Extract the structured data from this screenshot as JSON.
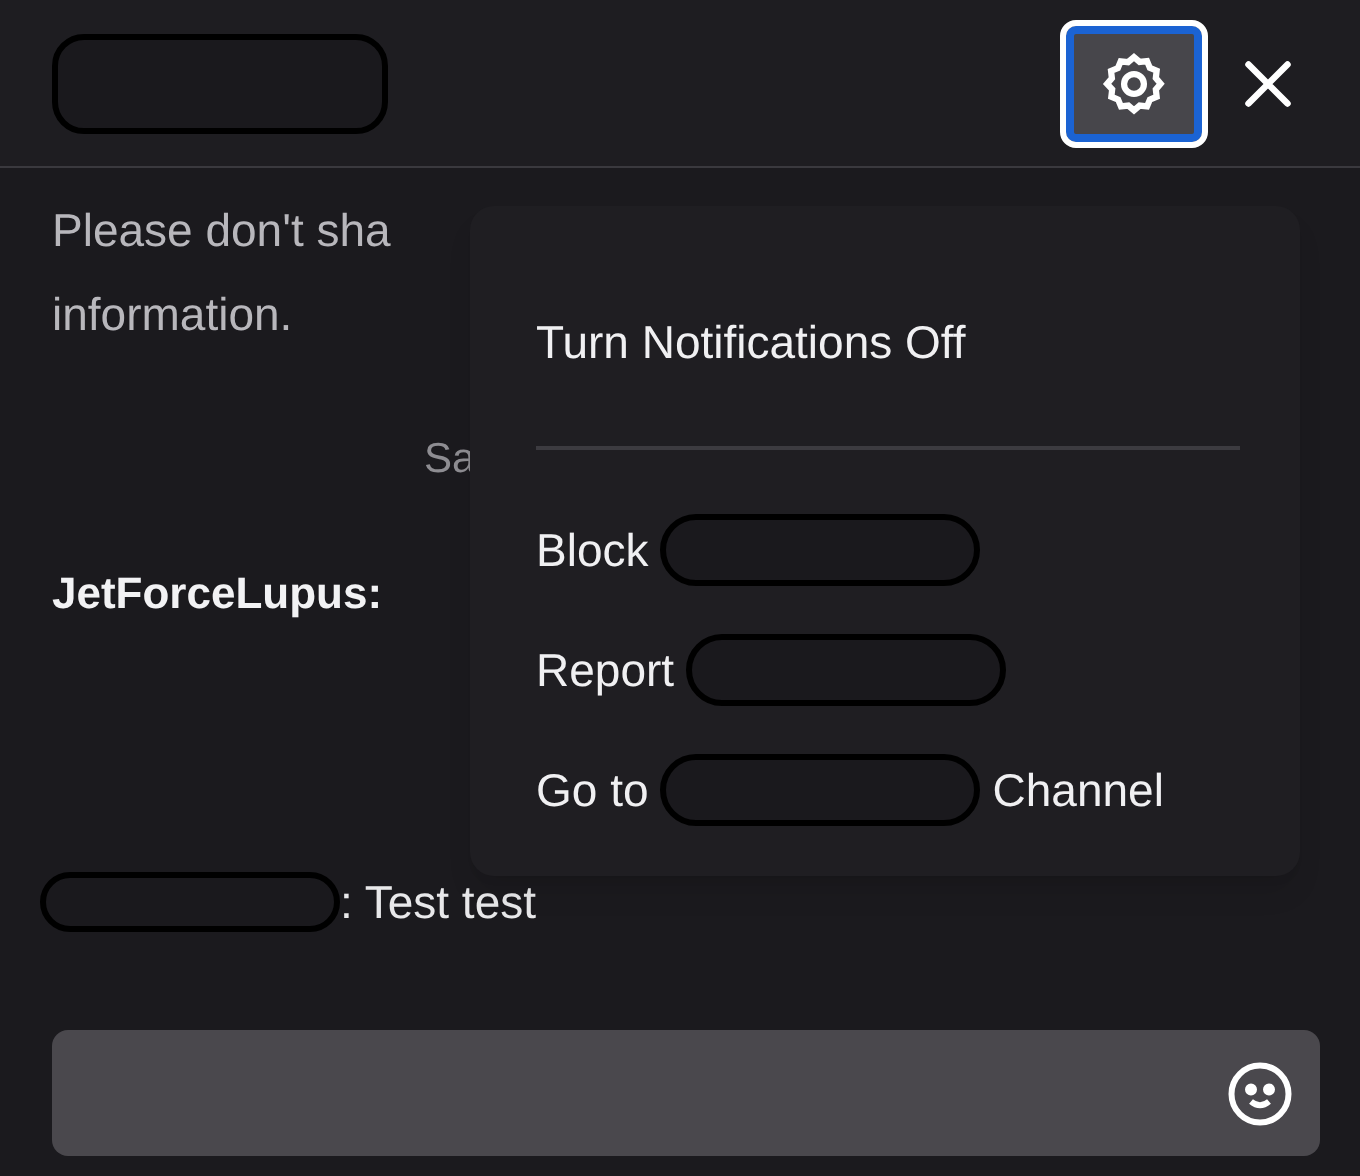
{
  "header": {
    "title_redacted": true,
    "settings_selected": true
  },
  "chat": [
    {
      "kind": "notice",
      "text": "Please don't sha"
    },
    {
      "kind": "notice",
      "text": "information."
    },
    {
      "kind": "center",
      "text": "Sa"
    },
    {
      "kind": "author",
      "text": "JetForceLupus:"
    },
    {
      "kind": "message",
      "redacted_author": true,
      "text": ": Test test"
    }
  ],
  "menu": [
    {
      "kind": "item",
      "parts": [
        {
          "kind": "text",
          "text": "Turn Notifications Off"
        }
      ]
    },
    {
      "kind": "divider"
    },
    {
      "kind": "item",
      "parts": [
        {
          "kind": "text",
          "text": "Block"
        },
        {
          "kind": "redaction"
        }
      ]
    },
    {
      "kind": "item",
      "parts": [
        {
          "kind": "text",
          "text": "Report"
        },
        {
          "kind": "redaction"
        }
      ]
    },
    {
      "kind": "item",
      "parts": [
        {
          "kind": "text",
          "text": "Go to"
        },
        {
          "kind": "redaction"
        },
        {
          "kind": "text",
          "text": "Channel"
        }
      ]
    }
  ]
}
